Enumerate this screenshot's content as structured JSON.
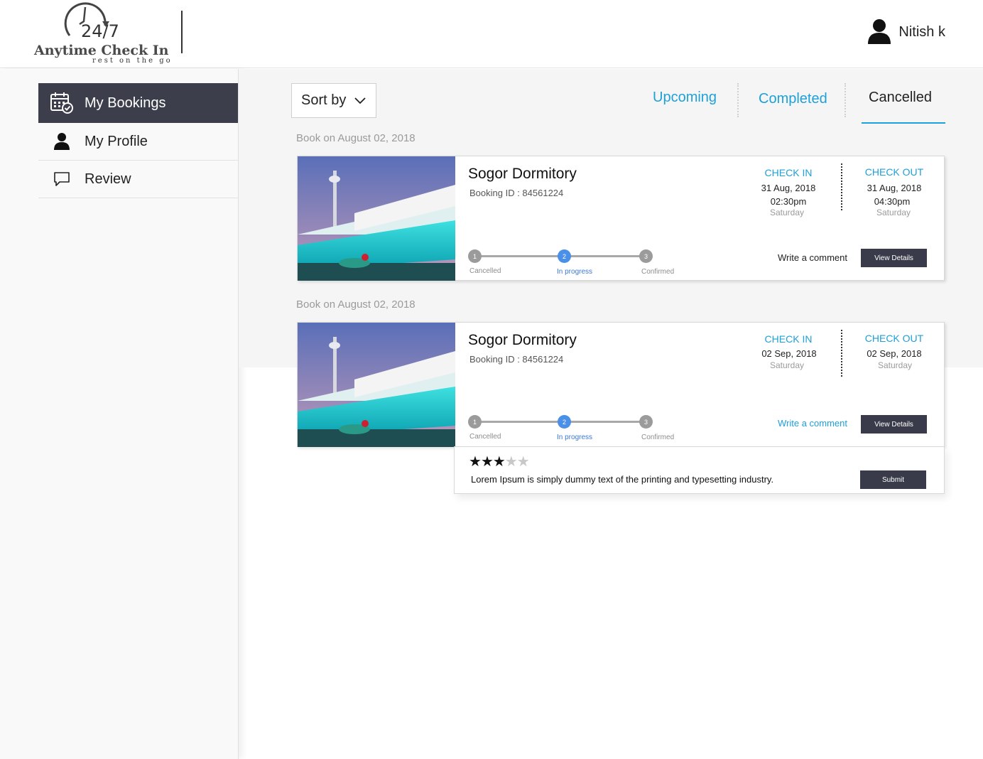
{
  "brand": {
    "hours": "24/7",
    "name": "Anytime Check In",
    "tagline": "rest on the go"
  },
  "user": {
    "name": "Nitish k",
    "icon": "user-icon"
  },
  "sidebar": {
    "items": [
      {
        "label": "My Bookings",
        "icon": "calendar-check-icon",
        "active": true
      },
      {
        "label": "My Profile",
        "icon": "user-icon",
        "active": false
      },
      {
        "label": "Review",
        "icon": "chat-bubble-icon",
        "active": false
      }
    ]
  },
  "toolbar": {
    "sort_label": "Sort by",
    "tabs": [
      {
        "label": "Upcoming",
        "color": "#1ea0d8"
      },
      {
        "label": "Completed",
        "color": "#1ea0d8"
      },
      {
        "label": "Cancelled",
        "active": true
      }
    ]
  },
  "bookings": [
    {
      "booked_on": "Book on August 02, 2018",
      "hotel": "Sogor Dormitory",
      "booking_id": "Booking ID : 84561224",
      "check_in_label": "CHECK IN",
      "check_in_date": "31 Aug, 2018",
      "check_in_time": "02:30pm",
      "check_in_day": "Saturday",
      "check_out_label": "CHECK OUT",
      "check_out_date": "31 Aug, 2018",
      "check_out_time": "04:30pm",
      "check_out_day": "Saturday",
      "steps": [
        {
          "num": "1",
          "label": "Cancelled"
        },
        {
          "num": "2",
          "label": "In progress",
          "active": true
        },
        {
          "num": "3",
          "label": "Confirmed"
        }
      ],
      "comment_link": "Write a comment",
      "details_button": "View Details"
    },
    {
      "booked_on": "Book on August 02, 2018",
      "hotel": "Sogor Dormitory",
      "booking_id": "Booking ID : 84561224",
      "check_in_label": "CHECK IN",
      "check_in_date": "02 Sep, 2018",
      "check_in_day": "Saturday",
      "check_out_label": "CHECK OUT",
      "check_out_date": "02 Sep, 2018",
      "check_out_day": "Saturday",
      "steps": [
        {
          "num": "1",
          "label": "Cancelled"
        },
        {
          "num": "2",
          "label": "In progress",
          "active": true
        },
        {
          "num": "3",
          "label": "Confirmed"
        }
      ],
      "comment_link": "Write a comment",
      "details_button": "View Details"
    }
  ],
  "review": {
    "rating": 3,
    "max_rating": 5,
    "text": "Lorem Ipsum is simply dummy text of the printing and typesetting industry.",
    "submit_label": "Submit"
  }
}
